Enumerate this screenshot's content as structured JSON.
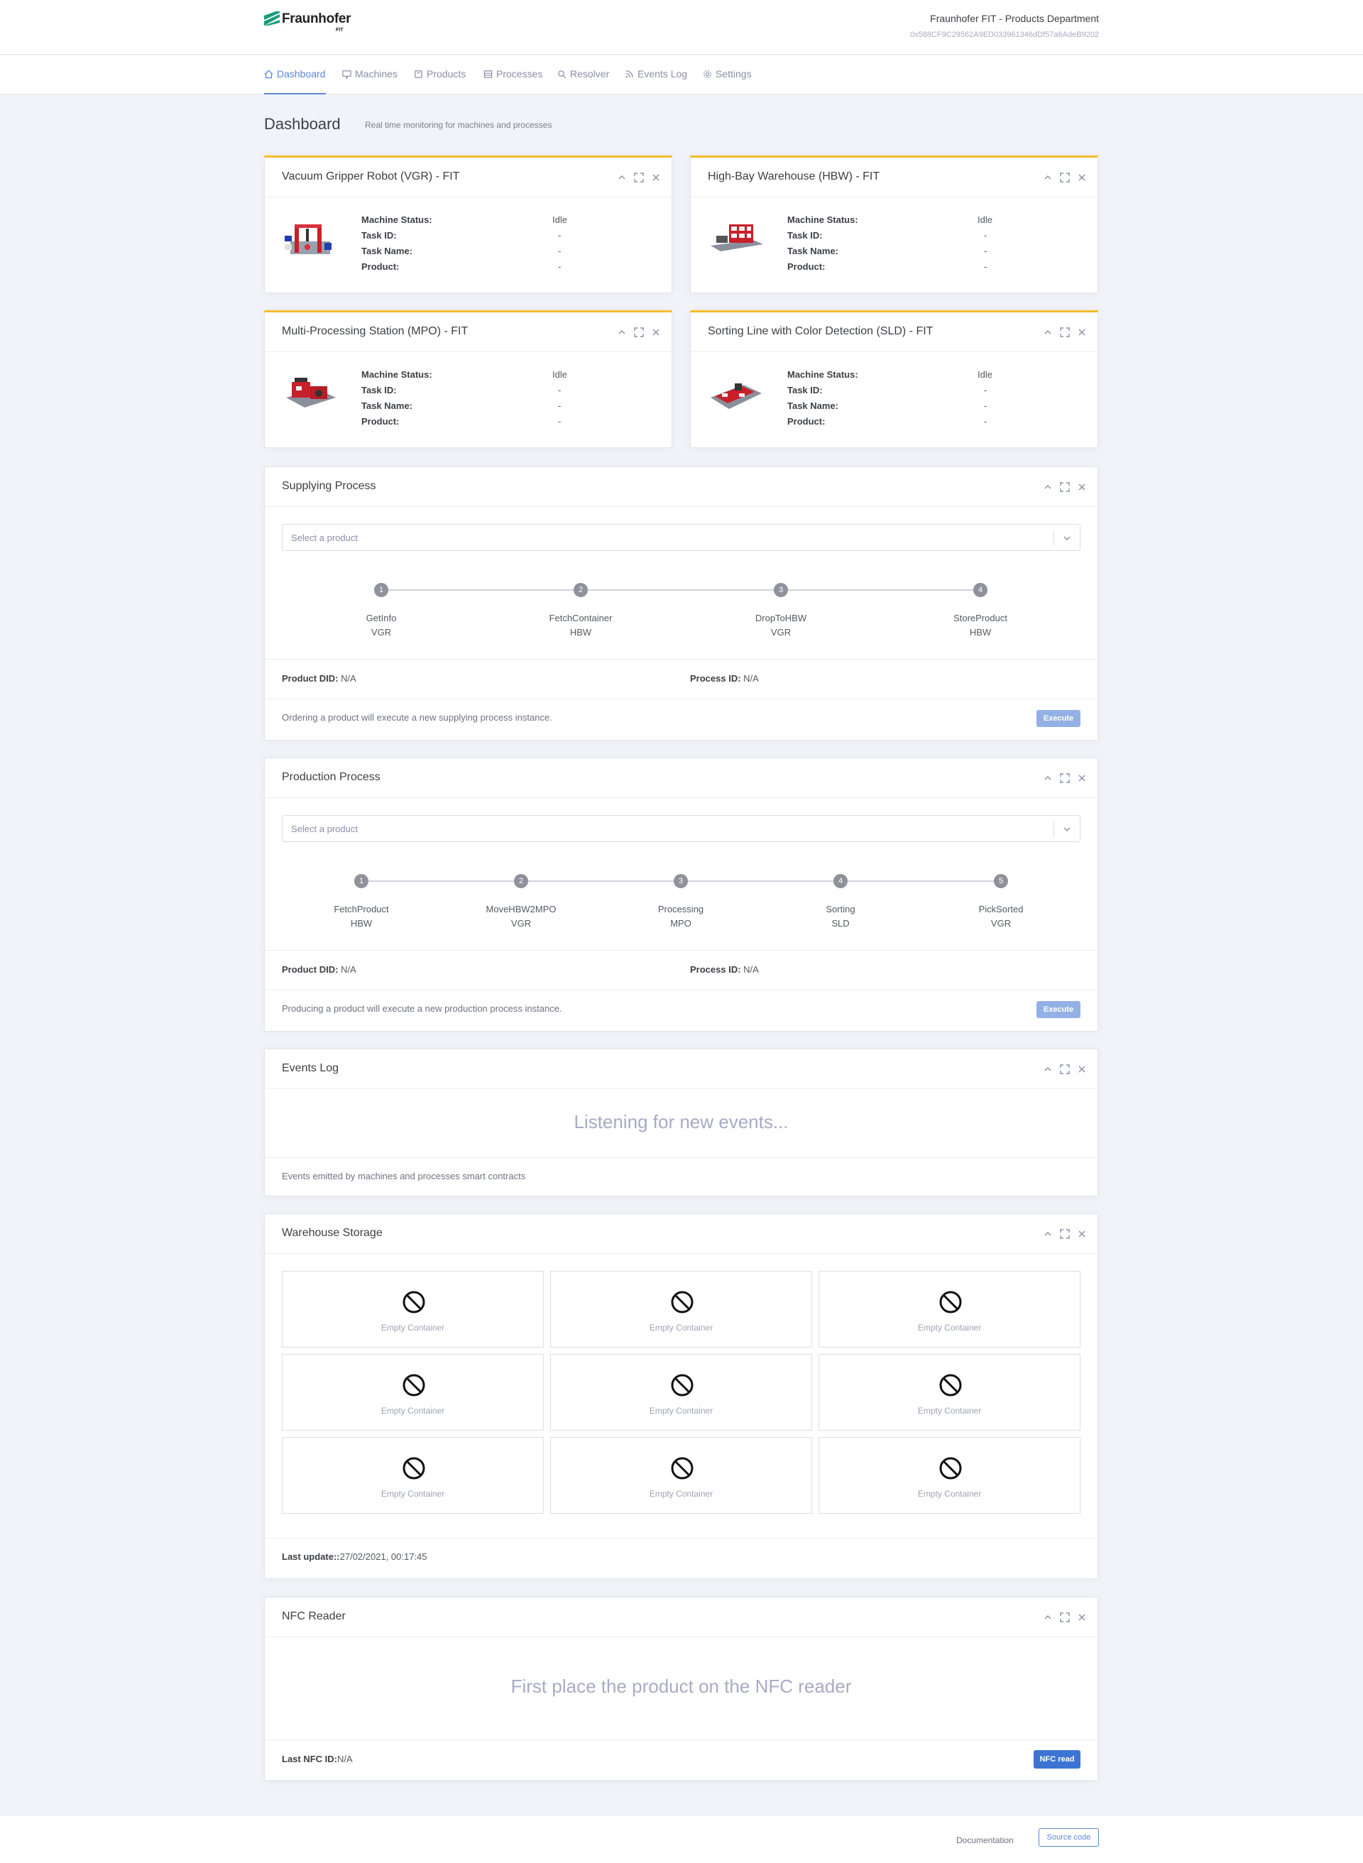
{
  "header": {
    "logo_text": "Fraunhofer",
    "logo_sub": "FIT",
    "org_name": "Fraunhofer FIT - Products Department",
    "org_address": "0x588CF9C29562A9ED033961346dDf57a6AdeB9202"
  },
  "nav": {
    "items": [
      {
        "label": "Dashboard",
        "icon": "home-icon",
        "active": true
      },
      {
        "label": "Machines",
        "icon": "monitor-icon"
      },
      {
        "label": "Products",
        "icon": "box-icon"
      },
      {
        "label": "Processes",
        "icon": "layers-icon"
      },
      {
        "label": "Resolver",
        "icon": "search-icon"
      },
      {
        "label": "Events Log",
        "icon": "rss-icon"
      },
      {
        "label": "Settings",
        "icon": "gear-icon"
      }
    ]
  },
  "page": {
    "title": "Dashboard",
    "subtitle": "Real time monitoring for machines and processes"
  },
  "labels": {
    "machine_status": "Machine Status:",
    "task_id": "Task ID:",
    "task_name": "Task Name:",
    "product": "Product:",
    "product_did": "Product DID:",
    "process_id": "Process ID:"
  },
  "machines": [
    {
      "title": "Vacuum Gripper Robot (VGR) - FIT",
      "status": "Idle",
      "task_id": "-",
      "task_name": "-",
      "product": "-"
    },
    {
      "title": "High-Bay Warehouse (HBW) - FIT",
      "status": "Idle",
      "task_id": "-",
      "task_name": "-",
      "product": "-"
    },
    {
      "title": "Multi-Processing Station (MPO) - FIT",
      "status": "Idle",
      "task_id": "-",
      "task_name": "-",
      "product": "-"
    },
    {
      "title": "Sorting Line with Color Detection (SLD) - FIT",
      "status": "Idle",
      "task_id": "-",
      "task_name": "-",
      "product": "-"
    }
  ],
  "supplying": {
    "title": "Supplying Process",
    "select_placeholder": "Select a product",
    "steps": [
      {
        "n": "1",
        "name": "GetInfo",
        "machine": "VGR"
      },
      {
        "n": "2",
        "name": "FetchContainer",
        "machine": "HBW"
      },
      {
        "n": "3",
        "name": "DropToHBW",
        "machine": "VGR"
      },
      {
        "n": "4",
        "name": "StoreProduct",
        "machine": "HBW"
      }
    ],
    "product_did": "N/A",
    "process_id": "N/A",
    "footnote": "Ordering a product will execute a new supplying process instance.",
    "button": "Execute"
  },
  "production": {
    "title": "Production Process",
    "select_placeholder": "Select a product",
    "steps": [
      {
        "n": "1",
        "name": "FetchProduct",
        "machine": "HBW"
      },
      {
        "n": "2",
        "name": "MoveHBW2MPO",
        "machine": "VGR"
      },
      {
        "n": "3",
        "name": "Processing",
        "machine": "MPO"
      },
      {
        "n": "4",
        "name": "Sorting",
        "machine": "SLD"
      },
      {
        "n": "5",
        "name": "PickSorted",
        "machine": "VGR"
      }
    ],
    "product_did": "N/A",
    "process_id": "N/A",
    "footnote": "Producing a product will execute a new production process instance.",
    "button": "Execute"
  },
  "events": {
    "title": "Events Log",
    "message": "Listening for new events...",
    "footnote": "Events emitted by machines and processes smart contracts"
  },
  "warehouse": {
    "title": "Warehouse Storage",
    "slots": [
      "Empty Container",
      "Empty Container",
      "Empty Container",
      "Empty Container",
      "Empty Container",
      "Empty Container",
      "Empty Container",
      "Empty Container",
      "Empty Container"
    ],
    "last_update_label": "Last update::",
    "last_update_value": "27/02/2021, 00:17:45"
  },
  "nfc": {
    "title": "NFC Reader",
    "message": "First place the product on the NFC reader",
    "last_id_label": "Last NFC ID:",
    "last_id_value": "N/A",
    "button": "NFC read"
  },
  "footer": {
    "documentation": "Documentation",
    "source_code": "Source code"
  },
  "colors": {
    "accent": "#5b87d8",
    "card_accent": "#f4bc2a",
    "brand_green": "#179c7d"
  }
}
